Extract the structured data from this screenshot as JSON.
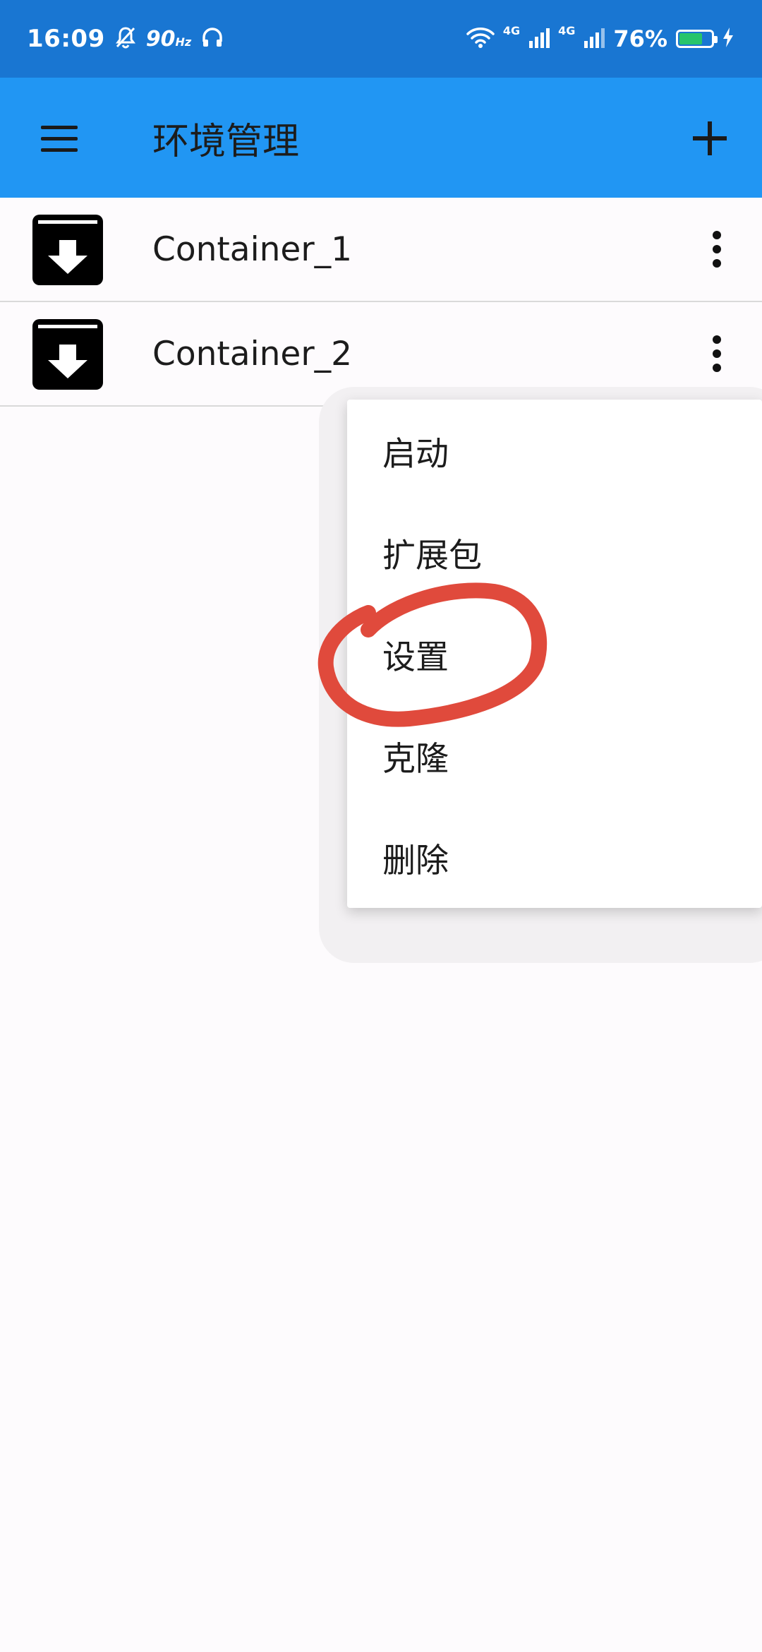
{
  "status_bar": {
    "time": "16:09",
    "refresh_rate": "90",
    "refresh_rate_unit": "Hz",
    "network_1": "4G",
    "network_2": "4G",
    "battery_percent": "76%",
    "battery_level": 0.76
  },
  "app_bar": {
    "title": "环境管理",
    "menu_icon": "hamburger-menu-icon",
    "add_icon": "plus-icon"
  },
  "containers": [
    {
      "label": "Container_1",
      "icon": "archive-download-icon"
    },
    {
      "label": "Container_2",
      "icon": "archive-download-icon"
    }
  ],
  "context_menu": {
    "items": [
      {
        "label": "启动"
      },
      {
        "label": "扩展包"
      },
      {
        "label": "设置"
      },
      {
        "label": "克隆"
      },
      {
        "label": "删除"
      }
    ]
  },
  "colors": {
    "status_bar": "#1976d2",
    "app_bar": "#2196f3",
    "annotation": "#e04a3c",
    "battery_fill": "#27c46b"
  }
}
